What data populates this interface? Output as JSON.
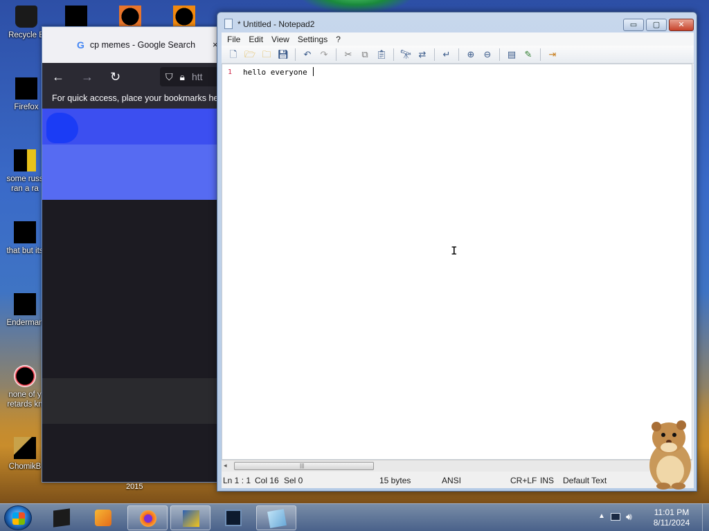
{
  "desktop": {
    "icons": [
      {
        "label": "Recycle B"
      },
      {
        "label": "Firefox"
      },
      {
        "label": "some russ ran a ra"
      },
      {
        "label": "that but its"
      },
      {
        "label": "Enderman"
      },
      {
        "label": "none of y retards kn"
      },
      {
        "label": "ChomikB"
      }
    ],
    "year_label": "2015"
  },
  "browser": {
    "tab_title": "cp memes - Google Search",
    "tab_close": "×",
    "url_partial": "htt",
    "bookmarks_hint": "For quick access, place your bookmarks here"
  },
  "notepad": {
    "title": "* Untitled - Notepad2",
    "buttons": {
      "minimize": "▭",
      "maximize": "▢",
      "close": "✕"
    },
    "menu": [
      "File",
      "Edit",
      "View",
      "Settings",
      "?"
    ],
    "editor": {
      "line_number": "1",
      "text": "hello everyone "
    },
    "status": {
      "position": "Ln 1 : 1",
      "col": "Col 16",
      "sel": "Sel 0",
      "size": "15 bytes",
      "encoding": "ANSI",
      "line_endings": "CR+LF",
      "mode": "INS",
      "scheme": "Default Text"
    }
  },
  "taskbar": {
    "clock_time": "11:01 PM",
    "clock_date": "8/11/2024",
    "tray_up": "▲"
  }
}
